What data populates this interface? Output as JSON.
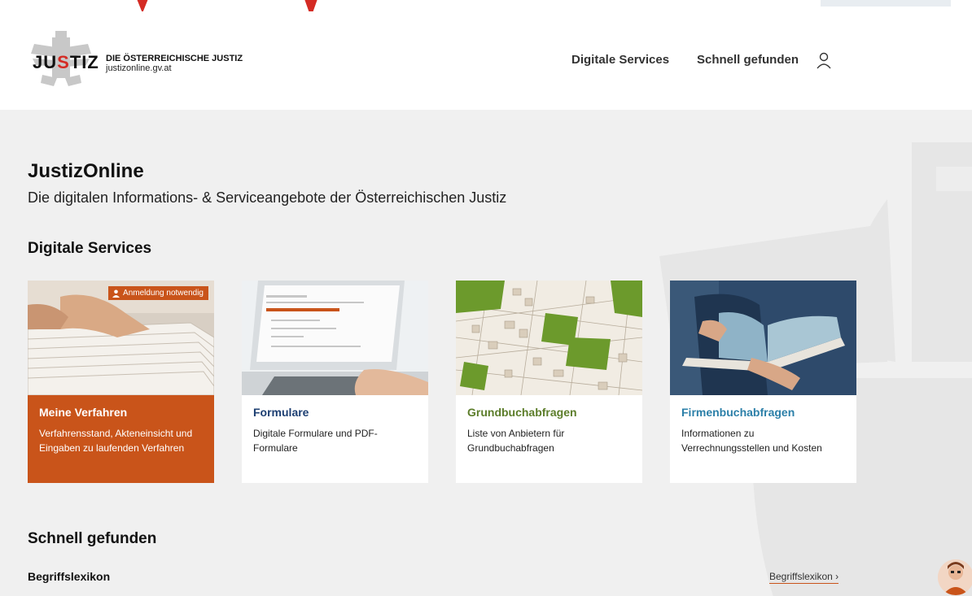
{
  "header": {
    "logo_text_prefix": "JU",
    "logo_text_s": "S",
    "logo_text_suffix": "TIZ",
    "brand_title": "DIE ÖSTERREICHISCHE JUSTIZ",
    "brand_subtitle": "justizonline.gv.at",
    "nav": [
      "Digitale Services",
      "Schnell gefunden"
    ],
    "user_icon": "user-icon"
  },
  "main": {
    "title": "JustizOnline",
    "subtitle": "Die digitalen Informations- & Serviceangebote der Österreichischen Justiz",
    "services_heading": "Digitale Services",
    "cards": [
      {
        "title": "Meine Verfahren",
        "description": "Verfahrensstand, Akteneinsicht und Eingaben zu laufenden Verfahren",
        "badge": "Anmeldung notwendig",
        "accent": "#c9541a"
      },
      {
        "title": "Formulare",
        "description": "Digitale Formulare und PDF-Formulare",
        "accent": "#1d3f72"
      },
      {
        "title": "Grundbuchabfragen",
        "description": "Liste von Anbietern für Grundbuchabfragen",
        "accent": "#5c7d2a"
      },
      {
        "title": "Firmenbuchabfragen",
        "description": "Informationen zu Verrechnungsstellen und Kosten",
        "accent": "#2b7fa8"
      }
    ],
    "quick_heading": "Schnell gefunden",
    "lexikon_label": "Begriffslexikon",
    "lexikon_link": "Begriffslexikon ›"
  },
  "colors": {
    "brand_red": "#d42b24",
    "background": "#f0f0f0"
  }
}
